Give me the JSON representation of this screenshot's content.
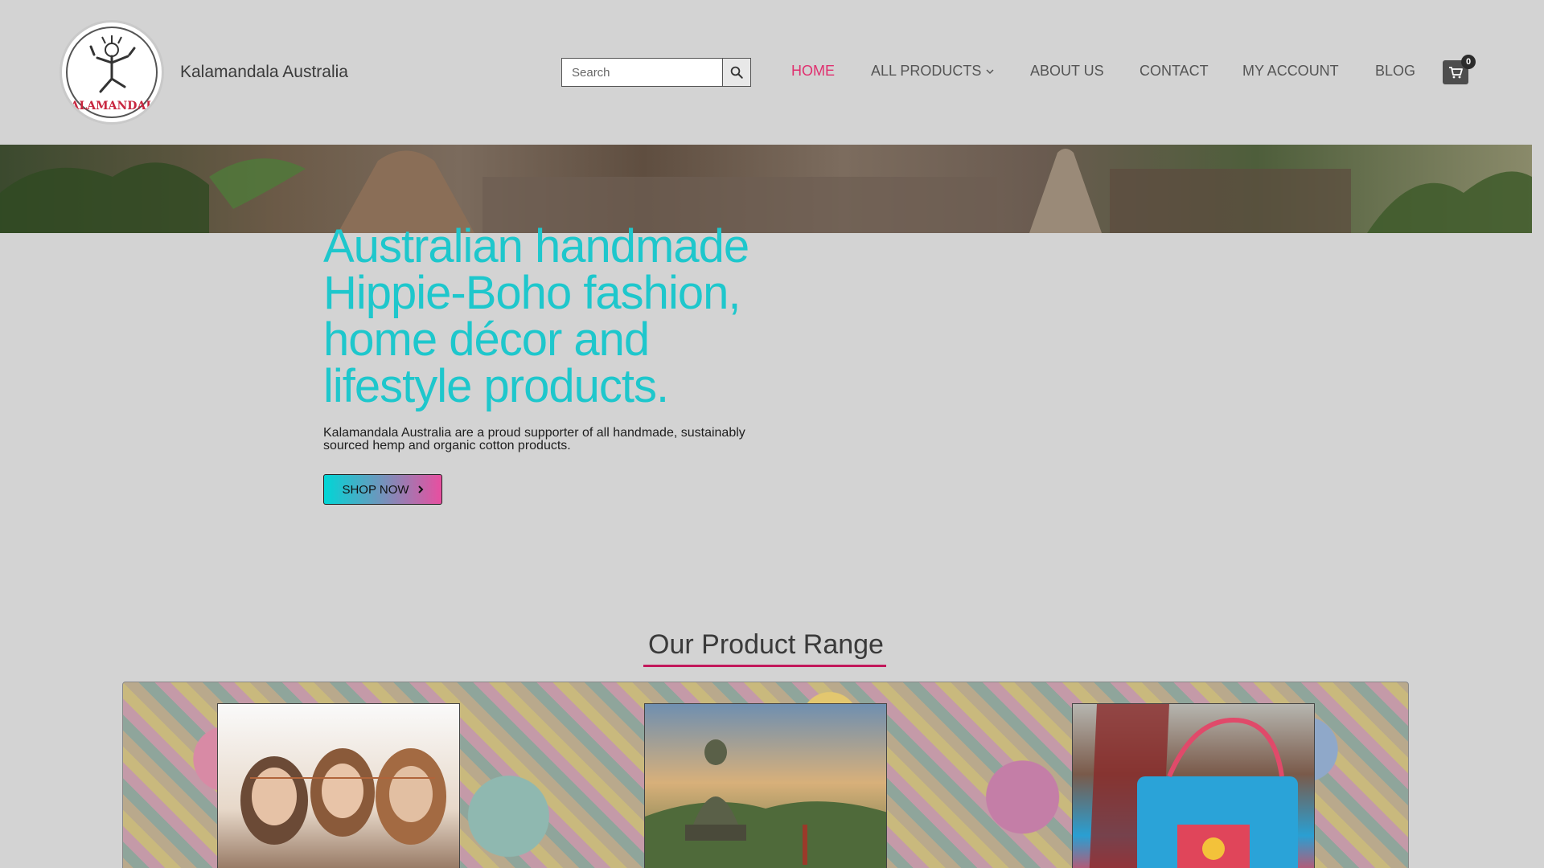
{
  "header": {
    "site_title": "Kalamandala Australia",
    "logo_text": "KALAMANDALA",
    "search": {
      "placeholder": "Search",
      "value": ""
    },
    "nav": [
      {
        "label": "HOME",
        "active": true
      },
      {
        "label": "ALL PRODUCTS",
        "has_dropdown": true
      },
      {
        "label": "ABOUT US"
      },
      {
        "label": "CONTACT"
      },
      {
        "label": "MY ACCOUNT"
      },
      {
        "label": "BLOG"
      }
    ],
    "cart_count": "0"
  },
  "hero": {
    "title": "Australian handmade Hippie-Boho fashion, home décor and lifestyle products.",
    "subtitle": "Kalamandala Australia are a proud supporter of all handmade, sustainably sourced hemp and organic cotton products.",
    "cta_label": "SHOP NOW"
  },
  "product_range": {
    "title": "Our Product Range"
  },
  "colors": {
    "accent_pink": "#e0306f",
    "hero_teal": "#1ec7cc",
    "underline": "#c2185b"
  },
  "icons": {
    "search": "magnifier-icon",
    "cart": "shopping-cart-icon",
    "dropdown": "chevron-down-icon",
    "cta": "chevron-right-icon"
  }
}
